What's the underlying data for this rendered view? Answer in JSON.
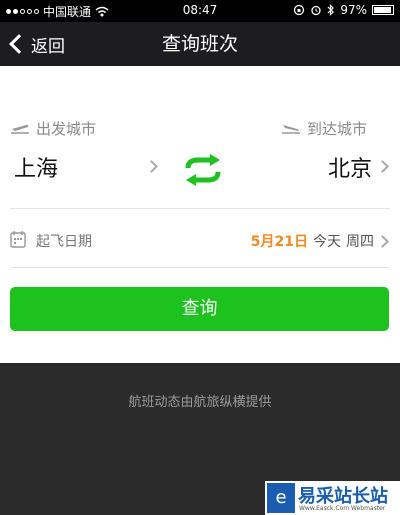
{
  "status_bar": {
    "carrier": "中国联通",
    "time": "08:47",
    "battery_text": "97%",
    "battery_level": 0.97
  },
  "nav": {
    "back_label": "返回",
    "title": "查询班次"
  },
  "search": {
    "from_label": "出发城市",
    "to_label": "到达城市",
    "from_city": "上海",
    "to_city": "北京",
    "date_label": "起飞日期",
    "date_value": "5月21日",
    "date_relative": "今天",
    "weekday": "周四",
    "query_button": "查询"
  },
  "footer": {
    "provider_text": "航班动态由航旅纵横提供"
  },
  "watermark": {
    "brand": "易采站长站",
    "url": "Www.Easck.Com Webmaster"
  },
  "colors": {
    "accent_green": "#1dc21f",
    "date_orange": "#f08a24"
  }
}
